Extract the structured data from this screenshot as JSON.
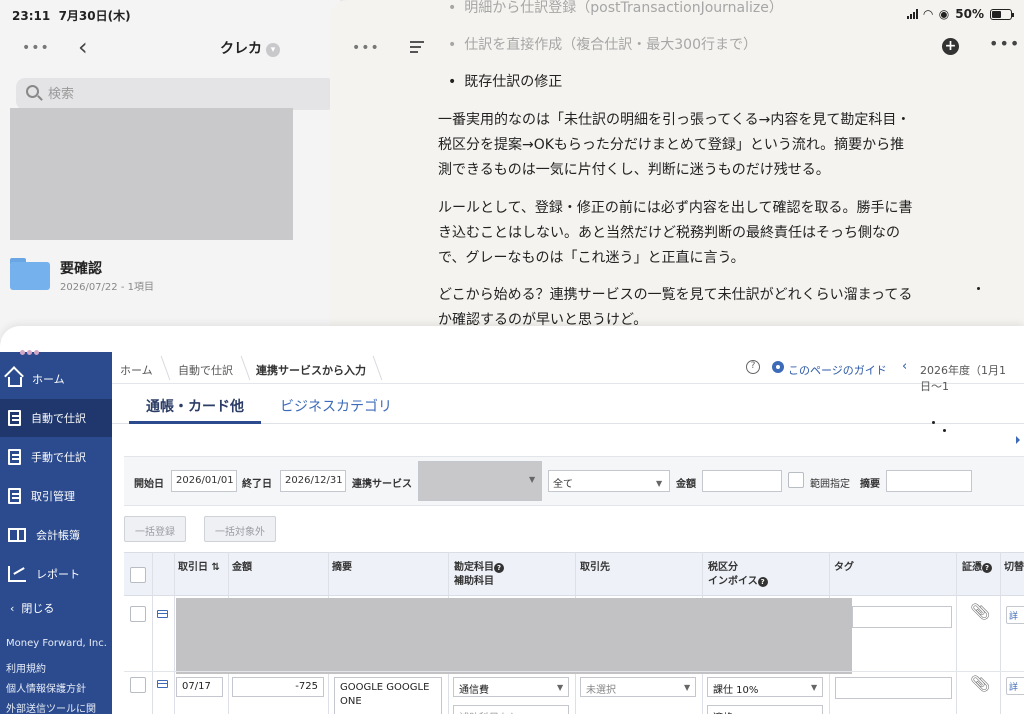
{
  "status_bar": {
    "time": "23:11",
    "date": "7月30日(木)",
    "battery": "50%",
    "battery_level": 0.5
  },
  "notes": {
    "title": "クレカ",
    "search_placeholder": "検索",
    "folder": {
      "name": "要確認",
      "meta": "2026/07/22 - 1項目"
    }
  },
  "chat": {
    "bullets": [
      "明細から仕訳登録（postTransactionJournalize）",
      "仕訳を直接作成（複合仕訳・最大300行まで）",
      "既存仕訳の修正"
    ],
    "paragraphs": [
      "一番実用的なのは「未仕訳の明細を引っ張ってくる→内容を見て勘定科目・税区分を提案→OKもらった分だけまとめて登録」という流れ。摘要から推測できるものは一気に片付くし、判断に迷うものだけ残せる。",
      "ルールとして、登録・修正の前には必ず内容を出して確認を取る。勝手に書き込むことはしない。あと当然だけど税務判断の最終責任はそっち側なので、グレーなものは「これ迷う」と正直に言う。",
      "どこから始める？連携サービスの一覧を見て未仕訳がどれくらい溜まってるか確認するのが早いと思うけど。"
    ]
  },
  "mf": {
    "sidebar": {
      "items": [
        {
          "label": "ホーム",
          "icon": "home-icon"
        },
        {
          "label": "自動で仕訳",
          "icon": "auto-journal-icon"
        },
        {
          "label": "手動で仕訳",
          "icon": "manual-journal-icon"
        },
        {
          "label": "取引管理",
          "icon": "transaction-icon"
        },
        {
          "label": "会計帳簿",
          "icon": "ledger-icon"
        },
        {
          "label": "レポート",
          "icon": "report-icon"
        }
      ],
      "close": "閉じる",
      "footer": [
        "Money Forward, Inc.",
        "利用規約",
        "個人情報保護方針",
        "外部送信ツールに関"
      ]
    },
    "breadcrumb": [
      "ホーム",
      "自動で仕訳",
      "連携サービスから入力"
    ],
    "guide": "このページのガイド",
    "fiscal_year": "2026年度（1月1日〜1",
    "tabs": [
      "通帳・カード他",
      "ビジネスカテゴリ"
    ],
    "filter": {
      "start_label": "開始日",
      "start_value": "2026/01/01",
      "end_label": "終了日",
      "end_value": "2026/12/31",
      "service_label": "連携サービス",
      "type_value": "全て",
      "amount_label": "金額",
      "range_label": "範囲指定",
      "memo_label": "摘要"
    },
    "buttons": {
      "bulk_register": "一括登録",
      "bulk_exclude": "一括対象外"
    },
    "columns": {
      "date": "取引日 ⇅",
      "amount": "金額",
      "memo": "摘要",
      "account": "勘定科目",
      "sub_account": "補助科目",
      "partner": "取引先",
      "tax": "税区分",
      "invoice": "インボイス",
      "tag": "タグ",
      "receipt": "証憑",
      "switch": "切替"
    },
    "row2": {
      "date": "07/17",
      "amount": "-725",
      "memo": "GOOGLE GOOGLE ONE",
      "account": "通信費",
      "partner": "未選択",
      "tax": "課仕 10%",
      "sub_account": "補助科目なし",
      "invoice": "適格",
      "switch_label": "詳"
    }
  }
}
